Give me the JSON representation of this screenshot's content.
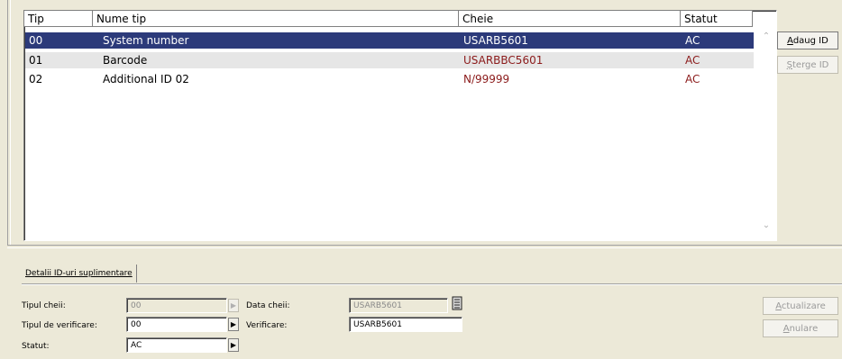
{
  "grid": {
    "columns": [
      "Tip",
      "Nume tip",
      "Cheie",
      "Statut"
    ],
    "rows": [
      {
        "tip": "00",
        "nume": "System number",
        "cheie": "USARB5601",
        "statut": "AC"
      },
      {
        "tip": "01",
        "nume": "Barcode",
        "cheie": "USARBBC5601",
        "statut": "AC"
      },
      {
        "tip": "02",
        "nume": "Additional ID 02",
        "cheie": "N/99999",
        "statut": "AC"
      }
    ]
  },
  "side_buttons": {
    "add": {
      "accel": "A",
      "rest": "daug ID"
    },
    "delete": {
      "accel": "Ș",
      "rest": "terge ID"
    }
  },
  "details": {
    "tab_label": "Detalii ID-uri suplimentare",
    "key_type_label": "Tipul cheii:",
    "key_type_value": "00",
    "verify_type_label": "Tipul de verificare:",
    "verify_type_value": "00",
    "status_label": "Statut:",
    "status_value": "AC",
    "key_data_label": "Data cheii:",
    "key_data_value": "USARB5601",
    "verification_label": "Verificare:",
    "verification_value": "USARB5601"
  },
  "action_buttons": {
    "update": {
      "accel": "A",
      "rest": "ctualizare"
    },
    "cancel": {
      "accel": "A",
      "rest": "nulare"
    }
  }
}
